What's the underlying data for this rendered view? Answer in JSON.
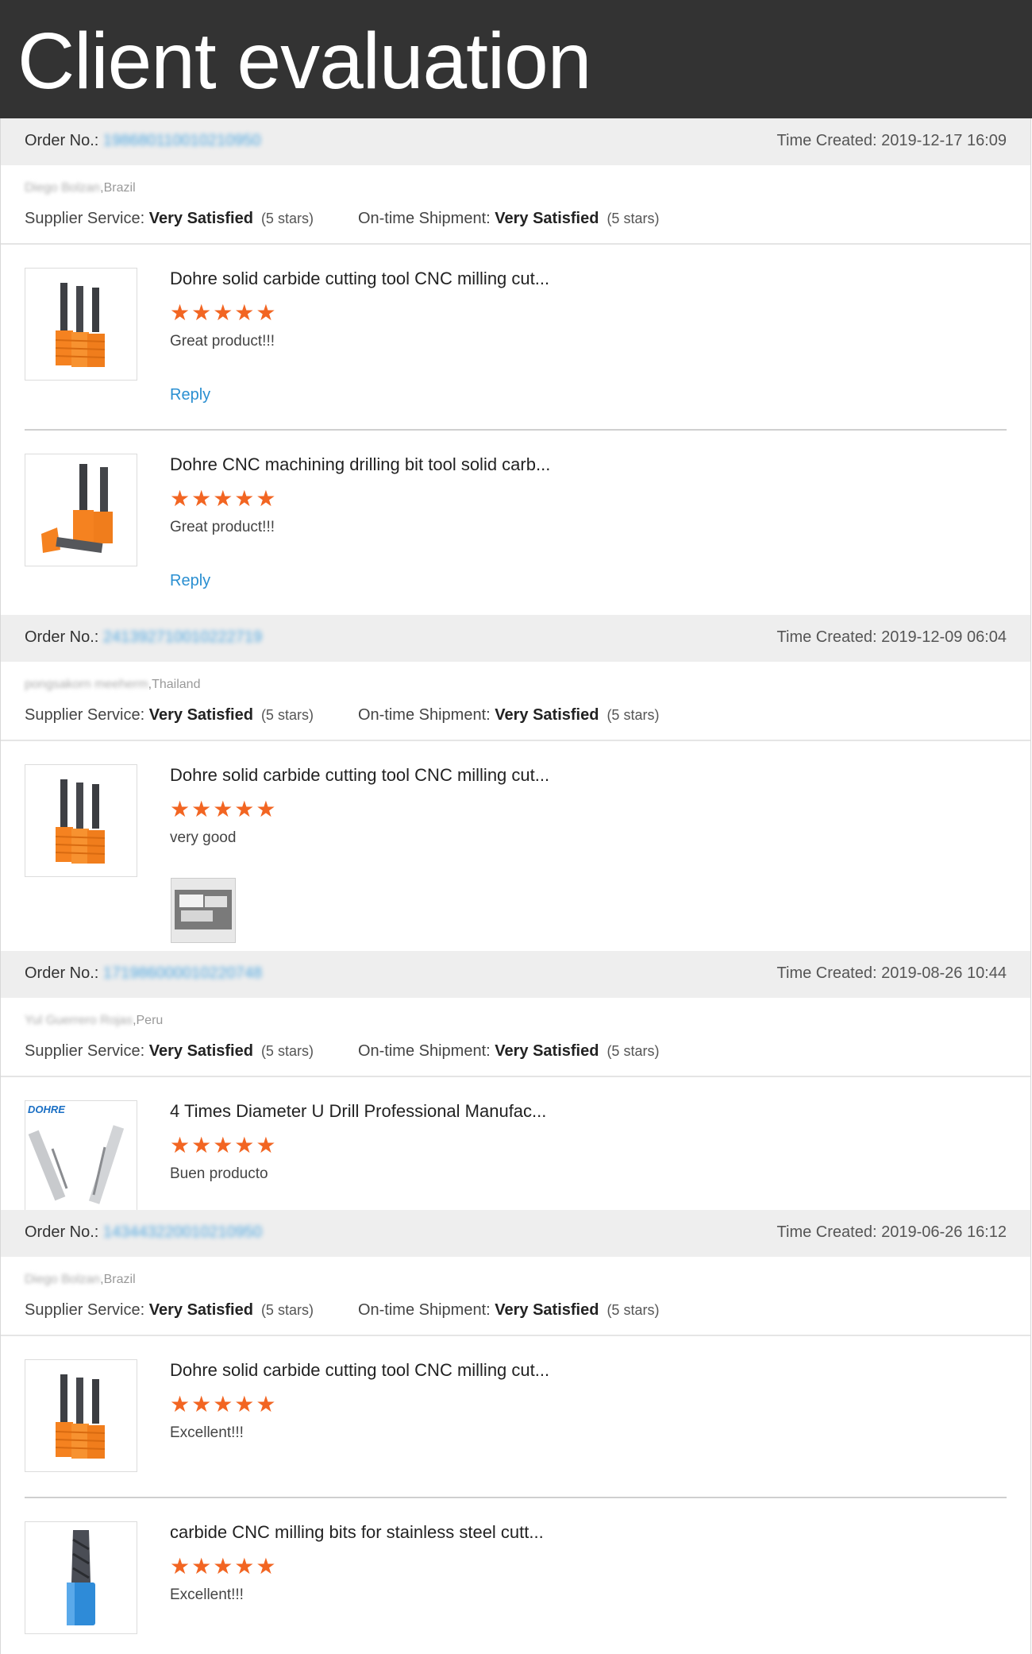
{
  "header": {
    "title": "Client evaluation"
  },
  "labels": {
    "order_no": "Order No.:",
    "time_created": "Time Created:",
    "supplier_service": "Supplier Service:",
    "on_time_shipment": "On-time Shipment:",
    "reply": "Reply"
  },
  "colors": {
    "accent_link": "#2a8fd1",
    "star": "#f26522",
    "header_bg": "#333333",
    "bar_bg": "#eeeeee"
  },
  "orders": [
    {
      "order_no": "198680110010210950",
      "time_created": "2019-12-17 16:09",
      "buyer_name": "Diego Bolzan",
      "buyer_country": ",Brazil",
      "supplier_service": "Very Satisfied",
      "supplier_stars": "(5 stars)",
      "shipment": "Very Satisfied",
      "shipment_stars": "(5 stars)",
      "items": [
        {
          "title": "Dohre solid carbide cutting tool CNC milling cut...",
          "stars": "★★★★★",
          "rating": 5,
          "comment": "Great product!!!",
          "reply": "Reply",
          "icon": "end-mill-three-orange"
        },
        {
          "title": "Dohre CNC machining drilling bit tool solid carb...",
          "stars": "★★★★★",
          "rating": 5,
          "comment": "Great product!!!",
          "reply": "Reply",
          "icon": "drill-bits-orange"
        }
      ]
    },
    {
      "order_no": "241392710010222719",
      "time_created": "2019-12-09 06:04",
      "buyer_name": "pongsakorn meeherm",
      "buyer_country": ",Thailand",
      "supplier_service": "Very Satisfied",
      "supplier_stars": "(5 stars)",
      "shipment": "Very Satisfied",
      "shipment_stars": "(5 stars)",
      "items": [
        {
          "title": "Dohre solid carbide cutting tool CNC milling cut...",
          "stars": "★★★★★",
          "rating": 5,
          "comment": "very good",
          "icon": "end-mill-three-orange",
          "has_photo": true
        }
      ]
    },
    {
      "order_no": "171986000010220748",
      "time_created": "2019-08-26 10:44",
      "buyer_name": "Yul Guerrero Rojas",
      "buyer_country": ",Peru",
      "supplier_service": "Very Satisfied",
      "supplier_stars": "(5 stars)",
      "shipment": "Very Satisfied",
      "shipment_stars": "(5 stars)",
      "items": [
        {
          "title": "4 Times Diameter U Drill Professional Manufac...",
          "stars": "★★★★★",
          "rating": 5,
          "comment": "Buen producto",
          "icon": "u-drill-dohre",
          "brand": "DOHRE"
        }
      ]
    },
    {
      "order_no": "143443220010210950",
      "time_created": "2019-06-26 16:12",
      "buyer_name": "Diego Bolzan",
      "buyer_country": ",Brazil",
      "supplier_service": "Very Satisfied",
      "supplier_stars": "(5 stars)",
      "shipment": "Very Satisfied",
      "shipment_stars": "(5 stars)",
      "items": [
        {
          "title": "Dohre solid carbide cutting tool CNC milling cut...",
          "stars": "★★★★★",
          "rating": 5,
          "comment": "Excellent!!!",
          "icon": "end-mill-three-orange"
        },
        {
          "title": "carbide CNC milling bits for stainless steel cutt...",
          "stars": "★★★★★",
          "rating": 5,
          "comment": "Excellent!!!",
          "icon": "end-mill-blue"
        }
      ]
    }
  ]
}
